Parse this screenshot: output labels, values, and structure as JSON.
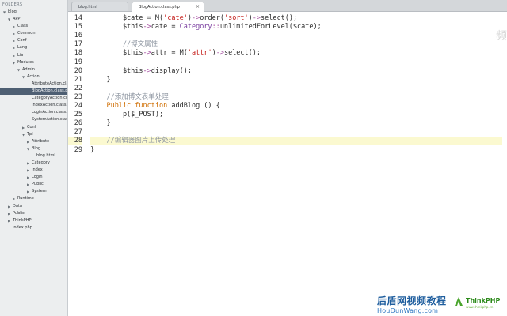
{
  "sidebar": {
    "header": "FOLDERS",
    "items": [
      {
        "label": "blog",
        "depth": 0,
        "arrow": "open"
      },
      {
        "label": "APP",
        "depth": 1,
        "arrow": "open"
      },
      {
        "label": "Class",
        "depth": 2,
        "arrow": "closed"
      },
      {
        "label": "Common",
        "depth": 2,
        "arrow": "closed"
      },
      {
        "label": "Conf",
        "depth": 2,
        "arrow": "closed"
      },
      {
        "label": "Lang",
        "depth": 2,
        "arrow": "closed"
      },
      {
        "label": "Lib",
        "depth": 2,
        "arrow": "closed"
      },
      {
        "label": "Modules",
        "depth": 2,
        "arrow": "open"
      },
      {
        "label": "Admin",
        "depth": 3,
        "arrow": "open"
      },
      {
        "label": "Action",
        "depth": 4,
        "arrow": "open"
      },
      {
        "label": "AttributeAction.class.php",
        "depth": 5,
        "arrow": ""
      },
      {
        "label": "BlogAction.class.php",
        "depth": 5,
        "arrow": "",
        "selected": true
      },
      {
        "label": "CategoryAction.class.php",
        "depth": 5,
        "arrow": ""
      },
      {
        "label": "IndexAction.class.php",
        "depth": 5,
        "arrow": ""
      },
      {
        "label": "LoginAction.class.php",
        "depth": 5,
        "arrow": ""
      },
      {
        "label": "SystemAction.class.php",
        "depth": 5,
        "arrow": ""
      },
      {
        "label": "Conf",
        "depth": 4,
        "arrow": "closed"
      },
      {
        "label": "Tpl",
        "depth": 4,
        "arrow": "open"
      },
      {
        "label": "Attribute",
        "depth": 5,
        "arrow": "closed"
      },
      {
        "label": "Blog",
        "depth": 5,
        "arrow": "open"
      },
      {
        "label": "blog.html",
        "depth": 6,
        "arrow": ""
      },
      {
        "label": "Category",
        "depth": 5,
        "arrow": "closed"
      },
      {
        "label": "Index",
        "depth": 5,
        "arrow": "closed"
      },
      {
        "label": "Login",
        "depth": 5,
        "arrow": "closed"
      },
      {
        "label": "Public",
        "depth": 5,
        "arrow": "closed"
      },
      {
        "label": "System",
        "depth": 5,
        "arrow": "closed"
      },
      {
        "label": "Runtime",
        "depth": 2,
        "arrow": "closed"
      },
      {
        "label": "Data",
        "depth": 1,
        "arrow": "closed"
      },
      {
        "label": "Public",
        "depth": 1,
        "arrow": "closed"
      },
      {
        "label": "ThinkPHP",
        "depth": 1,
        "arrow": "closed"
      },
      {
        "label": "index.php",
        "depth": 1,
        "arrow": ""
      }
    ]
  },
  "tabs": [
    {
      "label": "blog.html",
      "active": false,
      "close": ""
    },
    {
      "label": "BlogAction.class.php",
      "active": true,
      "close": "×"
    }
  ],
  "editor": {
    "current_line": "28",
    "lines": [
      {
        "n": "14",
        "tokens": [
          [
            "v",
            "        $cate = "
          ],
          [
            "fn",
            "M("
          ],
          [
            "s",
            "'cate'"
          ],
          [
            "fn",
            ")"
          ],
          [
            "ar",
            "->"
          ],
          [
            "fn",
            "order("
          ],
          [
            "s",
            "'sort'"
          ],
          [
            "fn",
            ")"
          ],
          [
            "ar",
            "->"
          ],
          [
            "fn",
            "select();"
          ]
        ]
      },
      {
        "n": "15",
        "tokens": [
          [
            "v",
            "        $this"
          ],
          [
            "ar",
            "->"
          ],
          [
            "v",
            "cate = "
          ],
          [
            "cls",
            "Category"
          ],
          [
            "ar",
            "::"
          ],
          [
            "fn",
            "unlimitedForLevel($cate);"
          ]
        ]
      },
      {
        "n": "16",
        "tokens": []
      },
      {
        "n": "17",
        "tokens": [
          [
            "c",
            "        //博文属性"
          ]
        ]
      },
      {
        "n": "18",
        "tokens": [
          [
            "v",
            "        $this"
          ],
          [
            "ar",
            "->"
          ],
          [
            "v",
            "attr = "
          ],
          [
            "fn",
            "M("
          ],
          [
            "s",
            "'attr'"
          ],
          [
            "fn",
            ")"
          ],
          [
            "ar",
            "->"
          ],
          [
            "fn",
            "select();"
          ]
        ]
      },
      {
        "n": "19",
        "tokens": []
      },
      {
        "n": "20",
        "tokens": [
          [
            "v",
            "        $this"
          ],
          [
            "ar",
            "->"
          ],
          [
            "fn",
            "display();"
          ]
        ]
      },
      {
        "n": "21",
        "tokens": [
          [
            "v",
            "    }"
          ]
        ]
      },
      {
        "n": "22",
        "tokens": []
      },
      {
        "n": "23",
        "tokens": [
          [
            "c",
            "    //添加博文表单处理"
          ]
        ]
      },
      {
        "n": "24",
        "tokens": [
          [
            "k",
            "    Public function "
          ],
          [
            "fn",
            "addBlog () {"
          ]
        ]
      },
      {
        "n": "25",
        "tokens": [
          [
            "fn",
            "        p($_POST);"
          ]
        ]
      },
      {
        "n": "26",
        "tokens": [
          [
            "v",
            "    }"
          ]
        ]
      },
      {
        "n": "27",
        "tokens": []
      },
      {
        "n": "28",
        "tokens": [
          [
            "c",
            "    //编辑器图片上传处理"
          ]
        ]
      },
      {
        "n": "29",
        "tokens": [
          [
            "v",
            "}"
          ]
        ]
      }
    ]
  },
  "watermark": {
    "brand_cn": "后盾网视频教程",
    "brand_en": "HouDunWang.com",
    "thinkphp_name": "ThinkPHP",
    "thinkphp_sub": "www.thinkphp.cn",
    "side_mark": "频"
  },
  "colors": {
    "keyword": "#cf6d00",
    "string": "#c41a16",
    "comment": "#8e96a1",
    "arrow": "#a24a9e",
    "sidebar_selected": "#4e5f73",
    "current_line": "#fbf9d0"
  }
}
